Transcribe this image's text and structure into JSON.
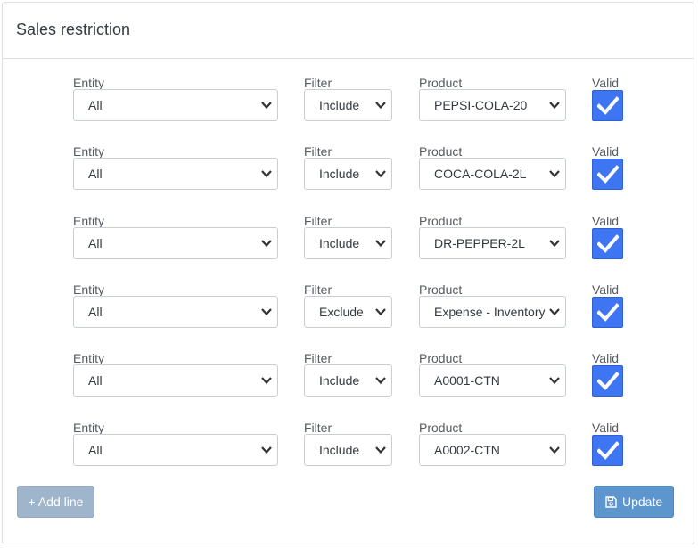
{
  "panel": {
    "title": "Sales restriction"
  },
  "labels": {
    "entity": "Entity",
    "filter": "Filter",
    "product": "Product",
    "valid": "Valid"
  },
  "rows": [
    {
      "entity": "All",
      "filter": "Include",
      "product": "PEPSI-COLA-20",
      "valid": true
    },
    {
      "entity": "All",
      "filter": "Include",
      "product": "COCA-COLA-2L",
      "valid": true
    },
    {
      "entity": "All",
      "filter": "Include",
      "product": "DR-PEPPER-2L",
      "valid": true
    },
    {
      "entity": "All",
      "filter": "Exclude",
      "product": "Expense - Inventory",
      "valid": true
    },
    {
      "entity": "All",
      "filter": "Include",
      "product": "A0001-CTN",
      "valid": true
    },
    {
      "entity": "All",
      "filter": "Include",
      "product": "A0002-CTN",
      "valid": true
    }
  ],
  "actions": {
    "add_line": "+ Add line",
    "update": "Update"
  },
  "colors": {
    "checkbox": "#3e75f2",
    "add_button": "#9fb5cc",
    "update_button": "#5d95cf"
  },
  "icons": {
    "select_arrow": "chevron-down-icon",
    "checkbox_mark": "check-icon",
    "update": "floppy-disk-icon"
  }
}
